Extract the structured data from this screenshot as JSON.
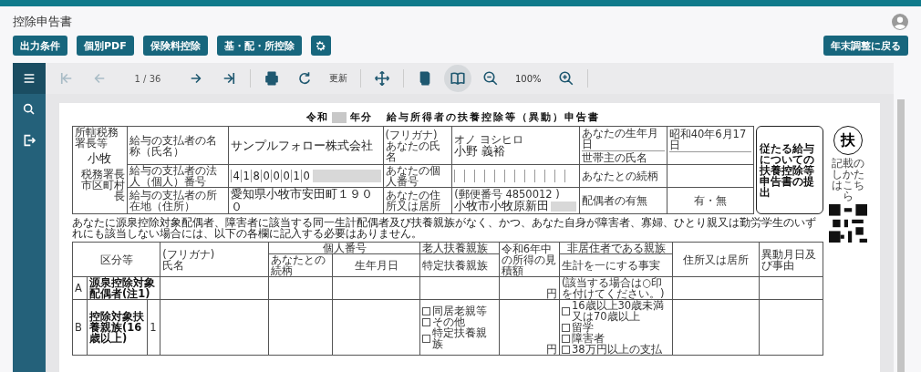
{
  "app": {
    "title": "控除申告書"
  },
  "actions": [
    {
      "label": "出力条件"
    },
    {
      "label": "個別PDF"
    },
    {
      "label": "保険料控除"
    },
    {
      "label": "基・配・所控除"
    }
  ],
  "back_button": {
    "label": "年末調整に戻る"
  },
  "sidebar": [
    {
      "kind": "menu",
      "selected": true
    },
    {
      "kind": "search",
      "selected": false
    },
    {
      "kind": "export",
      "selected": false
    }
  ],
  "toolbar": [
    {
      "kind": "first",
      "disabled": true
    },
    {
      "kind": "prev",
      "disabled": true
    },
    {
      "kind": "page",
      "text": "1 / 36"
    },
    {
      "kind": "next",
      "disabled": false
    },
    {
      "kind": "last",
      "disabled": false
    },
    {
      "kind": "print"
    },
    {
      "kind": "refresh"
    },
    {
      "kind": "label",
      "text": "更新"
    },
    {
      "kind": "move"
    },
    {
      "kind": "single",
      "selected": false
    },
    {
      "kind": "book",
      "selected": true
    },
    {
      "kind": "zoom-out"
    },
    {
      "kind": "zoom",
      "text": "100%"
    },
    {
      "kind": "zoom-in"
    }
  ],
  "form": {
    "title_prefix": "令和",
    "title_year": "年分",
    "title": "給与所得者の扶養控除等（異動）申告書",
    "office": {
      "label": "所轄税務署長等",
      "value": "小牧",
      "suffix": "税務署長",
      "city": "市区町村長"
    },
    "payer_name": {
      "label": "給与の支払者の名称（氏名）",
      "value": "サンプルフォロー株式会社"
    },
    "payer_number": {
      "label": "給与の支払者の法人（個人）番号",
      "digits": [
        "4",
        "1",
        "8",
        "0",
        "0",
        "0",
        "1",
        "0"
      ]
    },
    "payer_address": {
      "label": "給与の支払者の所在地（住所）",
      "value": "愛知県小牧市安田町１９００"
    },
    "furigana": {
      "label": "(フリガナ)",
      "value": "オノ ヨシヒロ"
    },
    "name": {
      "label": "あなたの氏名",
      "value": "小野 義裕"
    },
    "my_number": {
      "label": "あなたの個人番号"
    },
    "address": {
      "label": "あなたの住所又は居所",
      "postal": "(郵便番号 4850012 )",
      "value": "小牧市小牧原新田"
    },
    "birth": {
      "label": "あなたの生年月日",
      "value": "昭和40年6月17日"
    },
    "householder": {
      "label": "世帯主の氏名"
    },
    "relation": {
      "label": "あなたとの続柄"
    },
    "spouse": {
      "label": "配偶者の有無",
      "value": "有・無"
    },
    "side_box": "従たる給与についての扶養控除等申告書の提出",
    "stamp": "扶",
    "guide": "記載のしかたはこちら",
    "notice": "あなたに源泉控除対象配偶者、障害者に該当する同一生計配偶者及び扶養親族がなく、かつ、あなた自身が障害者、寡婦、ひとり親又は勤労学生のいずれにも該当しない場合には、以下の各欄に記入する必要はありません。",
    "columns": {
      "category": "区分等",
      "furigana": "(フリガナ)",
      "name": "氏名",
      "my_number": "個人番号",
      "relation": "あなたとの続柄",
      "birth": "生年月日",
      "elderly": "老人扶養親族",
      "specific": "特定扶養親族",
      "income": "令和6年中の所得の見積額",
      "nonresident": "非居住者である親族",
      "livelihood": "生計を一にする事実",
      "address": "住所又は居所",
      "change": "異動月日及び事由"
    },
    "row_a": {
      "letter": "A",
      "label": "源泉控除対象配偶者(注1)",
      "hint": "(該当する場合は○印を付けてください。)",
      "yen": "円"
    },
    "row_b": {
      "letter": "B",
      "label": "控除対象扶養親族(16歳以上)",
      "index": "1",
      "status_options": [
        {
          "label": "同居老親等",
          "checked": false
        },
        {
          "label": "その他",
          "checked": false
        },
        {
          "label": "特定扶養親族",
          "checked": false
        }
      ],
      "yen": "円",
      "nonresident_options": [
        {
          "label": "16歳以上30歳未満又は70歳以上",
          "checked": false
        },
        {
          "label": "留学",
          "checked": false
        },
        {
          "label": "障害者",
          "checked": false
        },
        {
          "label": "38万円以上の支払",
          "checked": false
        }
      ]
    }
  }
}
